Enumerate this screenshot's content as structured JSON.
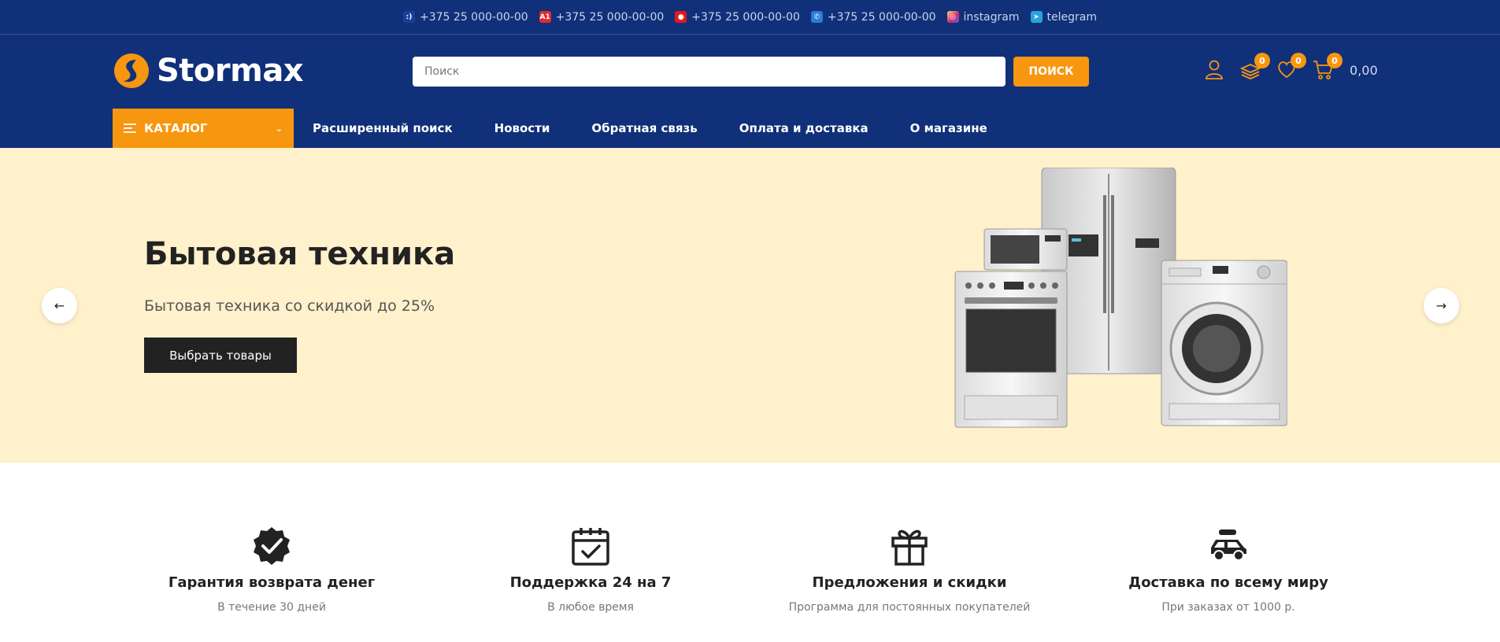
{
  "contacts": [
    {
      "icon": "mts-icon",
      "label": "+375 25 000-00-00",
      "color": "#1b3d9a",
      "glyph": ":)"
    },
    {
      "icon": "a1-icon",
      "label": "+375 25 000-00-00",
      "color": "#e32b2b",
      "glyph": "A1"
    },
    {
      "icon": "mts-red-icon",
      "label": "+375 25 000-00-00",
      "color": "#e3191b",
      "glyph": "●"
    },
    {
      "icon": "phone-icon",
      "label": "+375 25 000-00-00",
      "color": "#2a7dd4",
      "glyph": "✆"
    },
    {
      "icon": "instagram-icon",
      "label": "instagram",
      "color": "#d62976",
      "glyph": "◎"
    },
    {
      "icon": "telegram-icon",
      "label": "telegram",
      "color": "#2aa3dd",
      "glyph": "➤"
    }
  ],
  "header": {
    "brand": "Stormax",
    "search": {
      "placeholder": "Поиск",
      "value": "",
      "button": "ПОИСК"
    },
    "compare_count": "0",
    "wishlist_count": "0",
    "cart_count": "0",
    "cart_total": "0,00"
  },
  "nav": {
    "catalog": "КАТАЛОГ",
    "links": [
      "Расширенный поиск",
      "Новости",
      "Обратная связь",
      "Оплата и доставка",
      "О магазине"
    ]
  },
  "hero": {
    "title": "Бытовая техника",
    "subtitle": "Бытовая техника со скидкой до 25%",
    "button": "Выбрать товары"
  },
  "features": [
    {
      "icon": "check-badge-icon",
      "title": "Гарантия возврата денег",
      "subtitle": "В течение 30 дней"
    },
    {
      "icon": "calendar-icon",
      "title": "Поддержка 24 на 7",
      "subtitle": "В любое время"
    },
    {
      "icon": "gift-icon",
      "title": "Предложения и скидки",
      "subtitle": "Программа для постоянных покупателей"
    },
    {
      "icon": "car-icon",
      "title": "Доставка по всему миру",
      "subtitle": "При заказах от 1000 р."
    }
  ],
  "colors": {
    "primary": "#11307a",
    "accent": "#f7960f",
    "hero_bg": "#fef1cc",
    "dark_button": "#222222"
  }
}
